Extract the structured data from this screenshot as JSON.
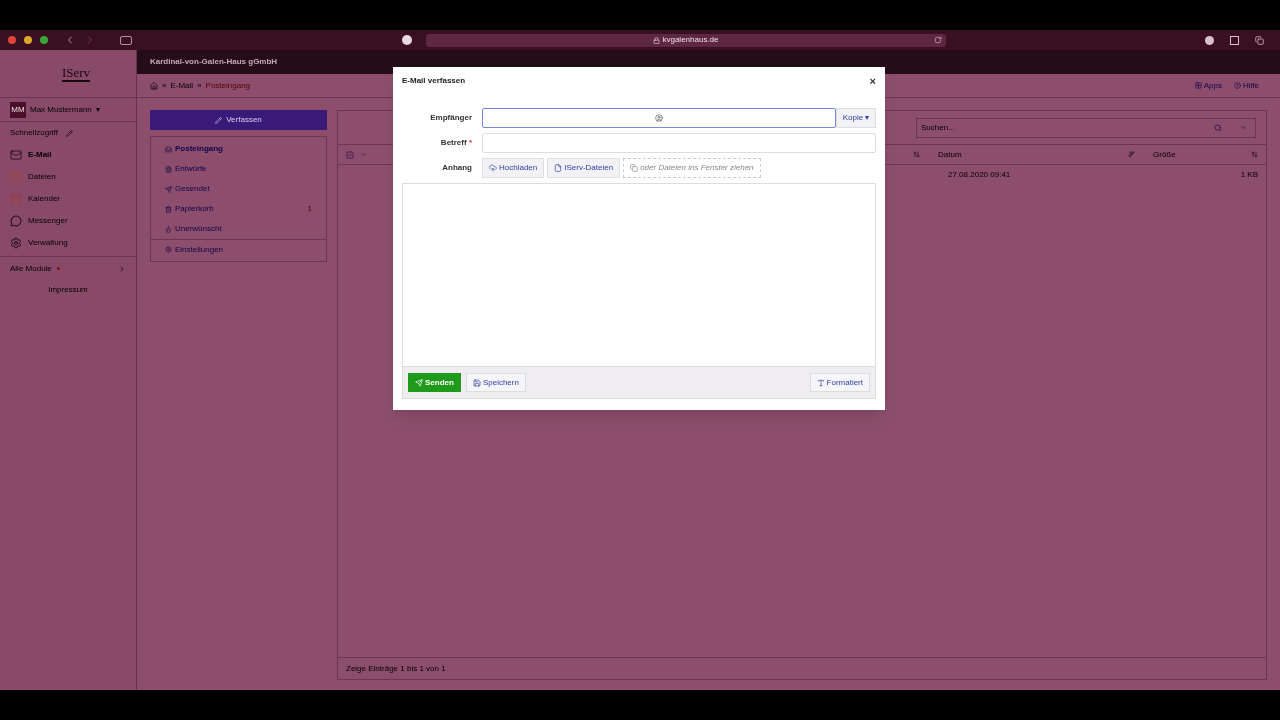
{
  "browser": {
    "url": "kvgalenhaus.de"
  },
  "sidebar": {
    "logo": "IServ",
    "user": {
      "initials": "MM",
      "name": "Max Mustermann",
      "caret": "▾"
    },
    "quick_access": "Schnellzugriff",
    "modules": [
      {
        "label": "E-Mail",
        "kind": "mail",
        "selected": true
      },
      {
        "label": "Dateien",
        "kind": "folder",
        "selected": false
      },
      {
        "label": "Kalender",
        "kind": "calendar",
        "selected": false
      },
      {
        "label": "Messenger",
        "kind": "chat",
        "selected": false
      },
      {
        "label": "Verwaltung",
        "kind": "gear",
        "selected": false
      }
    ],
    "all_modules": "Alle Module",
    "imprint": "Impressum"
  },
  "header": {
    "org": "Kardinal-von-Galen-Haus gGmbH",
    "breadcrumb": [
      {
        "separator": "»",
        "label": "E-Mail"
      },
      {
        "separator": "»",
        "label": "Posteingang"
      }
    ],
    "links": [
      {
        "label": "Apps",
        "kind": "apps"
      },
      {
        "label": "Hilfe",
        "kind": "help"
      }
    ]
  },
  "mail": {
    "compose": "Verfassen",
    "folders": [
      {
        "label": "Posteingang",
        "kind": "inbox",
        "selected": true
      },
      {
        "label": "Entwürfe",
        "kind": "draft",
        "selected": false
      },
      {
        "label": "Gesendet",
        "kind": "sent",
        "selected": false
      },
      {
        "label": "Papierkorb",
        "kind": "trash",
        "selected": false,
        "count": "1"
      },
      {
        "label": "Unerwünscht",
        "kind": "spam",
        "selected": false
      }
    ],
    "settings": "Einstellungen"
  },
  "list": {
    "search_placeholder": "Suchen...",
    "columns": [
      "Datum",
      "Größe"
    ],
    "rows": [
      {
        "date": "27.08.2020 09:41",
        "size": "1 KB"
      }
    ],
    "footer": "Zeige Einträge 1 bis 1 von 1"
  },
  "dialog": {
    "title": "E-Mail verfassen",
    "close": "×",
    "recipient_label": "Empfänger",
    "cc_button": "Kopie",
    "cc_caret": "▾",
    "subject_label": "Betreff",
    "required_mark": "*",
    "attachment_label": "Anhang",
    "upload": "Hochladen",
    "iserv_files": "IServ-Dateien",
    "drop_hint": "oder Dateien ins Fenster ziehen",
    "send": "Senden",
    "save": "Speichern",
    "format": "Formatiert"
  }
}
